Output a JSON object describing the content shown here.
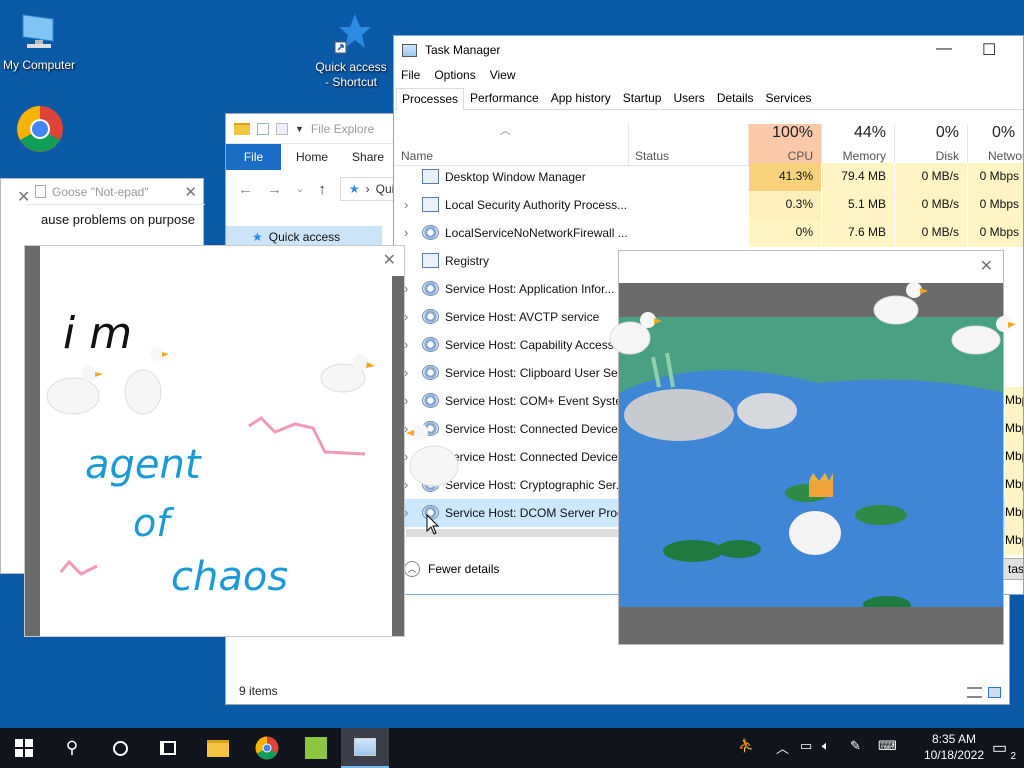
{
  "desktop": {
    "icons": [
      {
        "label": "My Computer"
      },
      {
        "label_line1": "Quick access",
        "label_line2": "- Shortcut"
      },
      {
        "label": "Google Chrome"
      }
    ]
  },
  "explorer": {
    "title": "File Explore",
    "ribbon_tabs": [
      "File",
      "Home",
      "Share"
    ],
    "address": "Quic",
    "nav_item": "Quick access",
    "status": "9 items"
  },
  "goose_note": {
    "title": "Goose \"Not-epad\"",
    "text": "ause problems on purpose"
  },
  "drawing": {
    "handwriting": [
      "i m",
      "agent",
      "of",
      "chaos"
    ]
  },
  "task_manager": {
    "title": "Task Manager",
    "menu": [
      "File",
      "Options",
      "View"
    ],
    "tabs": [
      "Processes",
      "Performance",
      "App history",
      "Startup",
      "Users",
      "Details",
      "Services"
    ],
    "active_tab": "Processes",
    "columns": {
      "name": "Name",
      "status": "Status",
      "cpu": {
        "pct": "100%",
        "label": "CPU"
      },
      "memory": {
        "pct": "44%",
        "label": "Memory"
      },
      "disk": {
        "pct": "0%",
        "label": "Disk"
      },
      "network": {
        "pct": "0%",
        "label": "Network"
      }
    },
    "processes": [
      {
        "name": "Desktop Window Manager",
        "cpu": "41.3%",
        "memory": "79.4 MB",
        "disk": "0 MB/s",
        "network": "0 Mbps",
        "expandable": false
      },
      {
        "name": "Local Security Authority Process...",
        "cpu": "0.3%",
        "memory": "5.1 MB",
        "disk": "0 MB/s",
        "network": "0 Mbps",
        "expandable": true
      },
      {
        "name": "LocalServiceNoNetworkFirewall ...",
        "cpu": "0%",
        "memory": "7.6 MB",
        "disk": "0 MB/s",
        "network": "0 Mbps",
        "expandable": true
      },
      {
        "name": "Registry",
        "expandable": false
      },
      {
        "name": "Service Host: Application Infor...",
        "expandable": true
      },
      {
        "name": "Service Host: AVCTP service",
        "expandable": true
      },
      {
        "name": "Service Host: Capability Access ...",
        "expandable": true
      },
      {
        "name": "Service Host: Clipboard User Ser...",
        "expandable": true
      },
      {
        "name": "Service Host: COM+ Event Syste...",
        "expandable": true
      },
      {
        "name": "Service Host: Connected Device...",
        "expandable": true
      },
      {
        "name": "Service Host: Connected Device...",
        "expandable": true
      },
      {
        "name": "Service Host: Cryptographic Ser...",
        "expandable": true
      },
      {
        "name": "Service Host: DCOM Server Proc...",
        "expandable": true
      }
    ],
    "partial_network": [
      "Mbp",
      "Mbp",
      "Mbp",
      "Mbp",
      "Mbp",
      "Mbp"
    ],
    "fewer_details": "Fewer details",
    "end_task_fragment": "tas"
  },
  "taskbar": {
    "time": "8:35 AM",
    "date": "10/18/2022",
    "notification_count": "2"
  },
  "colors": {
    "desktop": "#0b5aa7",
    "cpu_header": "#f9c9a8",
    "cpu_high": "#f8d27a",
    "heat_low": "#fff4c4",
    "selection": "#cce8ff",
    "taskbar": "#10141c"
  }
}
